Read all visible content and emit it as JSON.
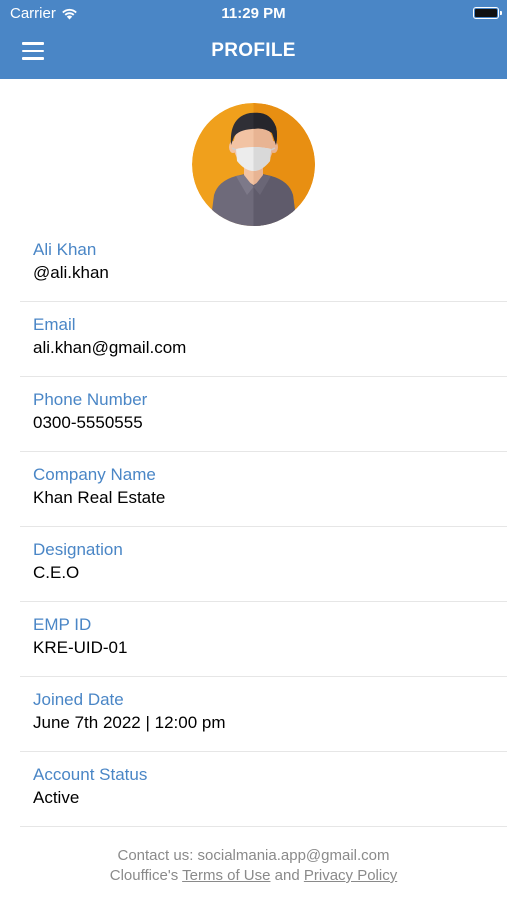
{
  "status_bar": {
    "carrier": "Carrier",
    "time": "11:29 PM"
  },
  "header": {
    "title": "PROFILE",
    "menu_icon": "hamburger-menu-icon",
    "color": "#4a86c6"
  },
  "profile": {
    "avatar_icon": "user-avatar-masked",
    "fields": [
      {
        "label": "Ali Khan",
        "value": "@ali.khan"
      },
      {
        "label": "Email",
        "value": "ali.khan@gmail.com"
      },
      {
        "label": "Phone Number",
        "value": "0300-5550555"
      },
      {
        "label": "Company Name",
        "value": "Khan Real Estate"
      },
      {
        "label": "Designation",
        "value": "C.E.O"
      },
      {
        "label": "EMP ID",
        "value": "KRE-UID-01"
      },
      {
        "label": "Joined Date",
        "value": "June 7th 2022 | 12:00 pm"
      },
      {
        "label": "Account Status",
        "value": "Active"
      }
    ]
  },
  "footer": {
    "contact": "Contact us: socialmania.app@gmail.com",
    "prefix": "Clouffice's",
    "terms": "Terms of Use",
    "and": "and",
    "privacy": "Privacy Policy"
  }
}
